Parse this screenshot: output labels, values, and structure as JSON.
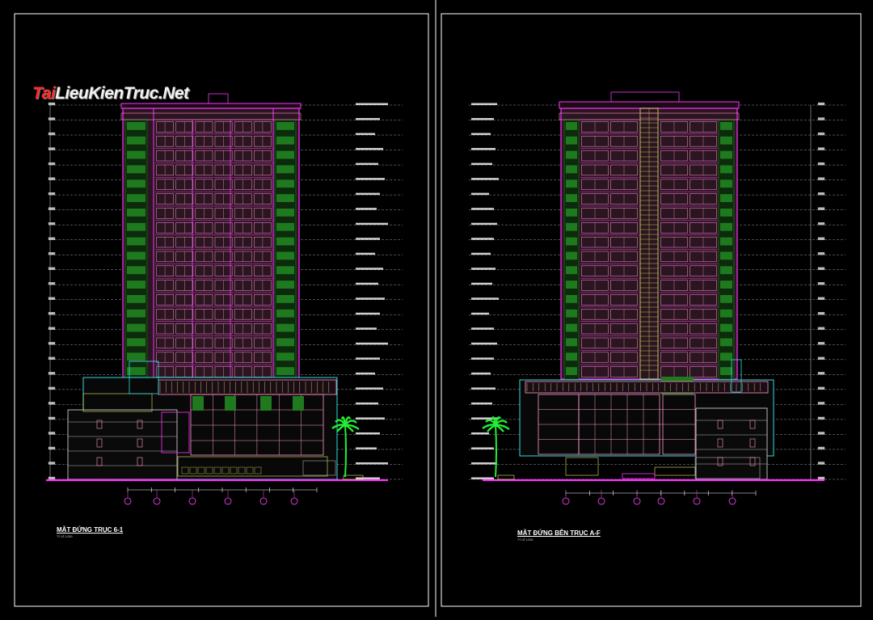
{
  "watermark": {
    "prefix": "Tai",
    "rest": "LieuKienTruc.Net"
  },
  "sheets": [
    {
      "id": "left",
      "title": "MẶT ĐỨNG TRỤC 6-1",
      "scale": "TỶ LỆ 1/200",
      "axis_count": 6
    },
    {
      "id": "right",
      "title": "MẶT ĐỨNG BÊN TRỤC A-F",
      "scale": "TỶ LỆ 1/200",
      "axis_count": 6
    }
  ],
  "colors": {
    "background": "#000000",
    "frame": "#ffffff",
    "outline": "#ff33ff",
    "window": "#ff99cc",
    "facade_fill": "#2a1520",
    "greenery": "#1f7a1f",
    "cyan": "#33dddd",
    "yellow": "#e8e86a",
    "palm": "#22ee33",
    "dim_line": "#9a9a9a"
  }
}
